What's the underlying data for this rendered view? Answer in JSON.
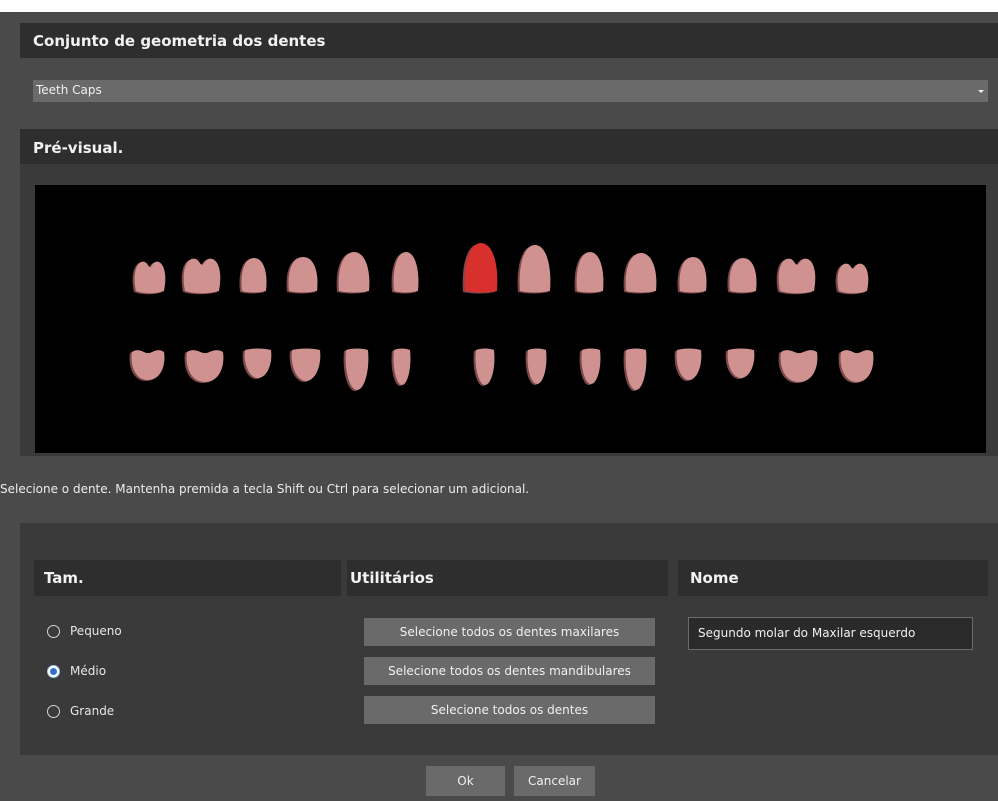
{
  "geometry_section": {
    "title": "Conjunto de geometria dos dentes",
    "selected": "Teeth Caps"
  },
  "preview_section": {
    "title": "Pré-visual."
  },
  "tooth_colors": {
    "normal": "#cf9291",
    "shadow": "#7a4a4a",
    "selected": "#d8302c"
  },
  "instruction": "Selecione o dente. Mantenha premida a tecla Shift ou Ctrl para selecionar um adicional.",
  "size": {
    "title": "Tam.",
    "options": [
      {
        "label": "Pequeno",
        "checked": false
      },
      {
        "label": "Médio",
        "checked": true
      },
      {
        "label": "Grande",
        "checked": false
      }
    ]
  },
  "utilities": {
    "title": "Utilitários",
    "buttons": [
      "Selecione todos os dentes maxilares",
      "Selecione todos os dentes mandibulares",
      "Selecione todos os dentes"
    ]
  },
  "name": {
    "title": "Nome",
    "value": "Segundo molar do Maxilar esquerdo"
  },
  "footer": {
    "ok": "Ok",
    "cancel": "Cancelar"
  }
}
